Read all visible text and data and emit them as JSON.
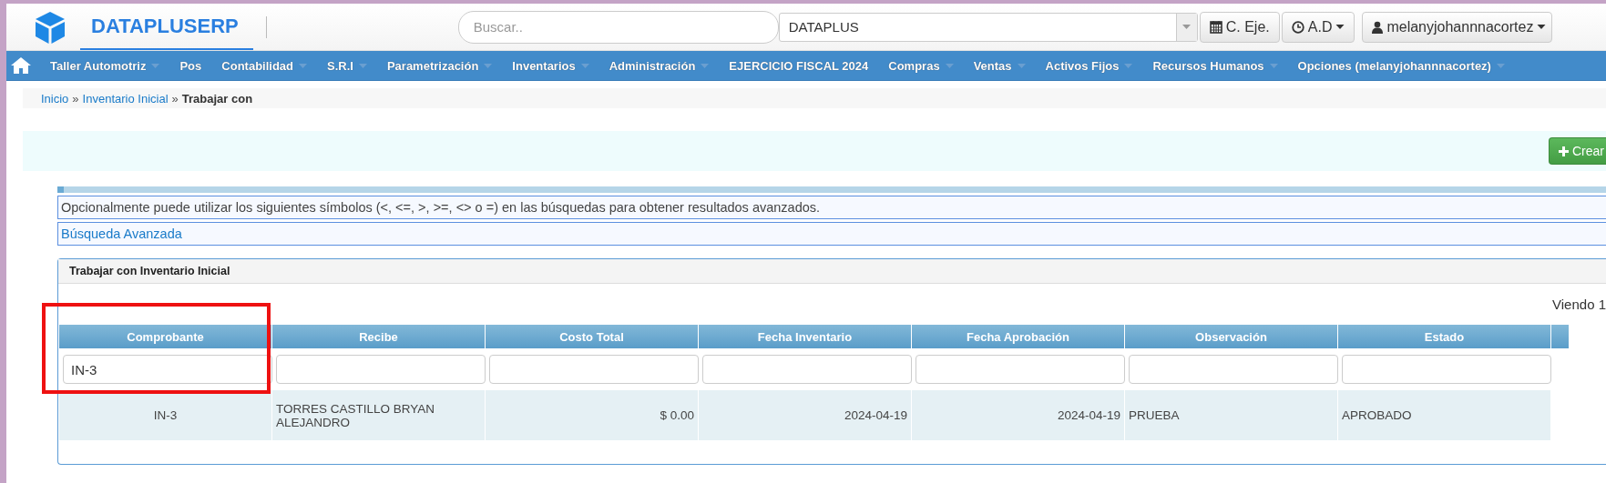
{
  "header": {
    "brand": "DATAPLUSERP",
    "search": {
      "placeholder": "Buscar.."
    },
    "company_select": {
      "value": "DATAPLUS"
    },
    "buttons": [
      {
        "kind": "calendar",
        "label": "C. Eje.",
        "dropdown": false
      },
      {
        "kind": "clock",
        "label": "A.D",
        "dropdown": true
      },
      {
        "kind": "user",
        "label": "melanyjohannnacortez",
        "dropdown": true
      }
    ]
  },
  "menu": [
    {
      "label": "Taller Automotriz",
      "dropdown": true
    },
    {
      "label": "Pos",
      "dropdown": false
    },
    {
      "label": "Contabilidad",
      "dropdown": true
    },
    {
      "label": "S.R.I",
      "dropdown": true
    },
    {
      "label": "Parametrización",
      "dropdown": true
    },
    {
      "label": "Inventarios",
      "dropdown": true
    },
    {
      "label": "Administración",
      "dropdown": true
    },
    {
      "label": "EJERCICIO FISCAL 2024",
      "dropdown": false
    },
    {
      "label": "Compras",
      "dropdown": true
    },
    {
      "label": "Ventas",
      "dropdown": true
    },
    {
      "label": "Activos Fijos",
      "dropdown": true
    },
    {
      "label": "Recursos Humanos",
      "dropdown": true
    },
    {
      "label": "Opciones (melanyjohannnacortez)",
      "dropdown": true
    }
  ],
  "breadcrumb": {
    "separator": "»",
    "items": [
      {
        "label": "Inicio",
        "link": true
      },
      {
        "label": "Inventario Inicial",
        "link": true
      },
      {
        "label": "Trabajar con",
        "link": false
      }
    ]
  },
  "create_button": "Crear",
  "hint": "Opcionalmente puede utilizar los siguientes símbolos (<, <=, >, >=, <> o =) en las búsquedas para obtener resultados avanzados.",
  "advanced_search": "Búsqueda Avanzada",
  "grid": {
    "title": "Trabajar con Inventario Inicial",
    "pager": "Viendo 1",
    "columns": [
      {
        "label": "Comprobante",
        "filter": "IN-3"
      },
      {
        "label": "Recibe"
      },
      {
        "label": "Costo Total"
      },
      {
        "label": "Fecha Inventario"
      },
      {
        "label": "Fecha Aprobación"
      },
      {
        "label": "Observación"
      },
      {
        "label": "Estado"
      }
    ],
    "rows": [
      {
        "cells": [
          "IN-3",
          "TORRES CASTILLO BRYAN ALEJANDRO",
          "$ 0.00",
          "2024-04-19",
          "2024-04-19",
          "PRUEBA",
          "APROBADO"
        ]
      }
    ]
  },
  "annotations": [
    {
      "kind": "rectangle",
      "color": "#ee1111"
    }
  ]
}
